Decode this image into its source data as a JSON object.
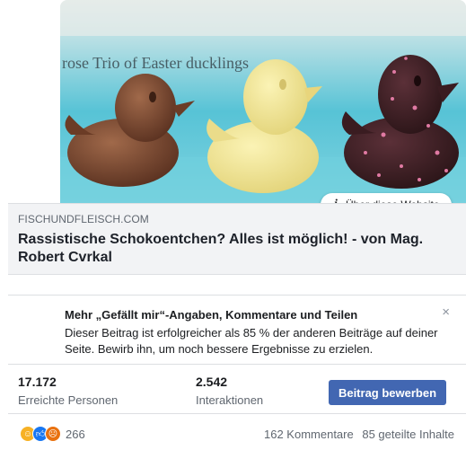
{
  "post": {
    "image_caption_text": "rose Trio of Easter ducklings",
    "site_info_label": "Über diese Website",
    "domain": "FISCHUNDFLEISCH.COM",
    "headline": "Rassistische Schokoentchen? Alles ist möglich! - von Mag. Robert Cvrkal"
  },
  "promo": {
    "title": "Mehr „Gefällt mir“-Angaben, Kommentare und Teilen",
    "text": "Dieser Beitrag ist erfolgreicher als 85 % der anderen Beiträge auf deiner Seite. Bewirb ihn, um noch bessere Ergebnisse zu erzielen.",
    "close_symbol": "×"
  },
  "stats": {
    "reach_value": "17.172",
    "reach_label": "Erreichte Personen",
    "interactions_value": "2.542",
    "interactions_label": "Interaktionen",
    "boost_label": "Beitrag bewerben"
  },
  "reactions": {
    "icons": [
      "haha-icon",
      "like-icon",
      "angry-icon"
    ],
    "count": "266",
    "comments": "162 Kommentare",
    "shares": "85 geteilte Inhalte"
  },
  "colors": {
    "accent": "#4267b2",
    "meta_bg": "#f2f3f5",
    "haha": "#f7b125",
    "like": "#1877f2",
    "angry": "#e9710f"
  }
}
